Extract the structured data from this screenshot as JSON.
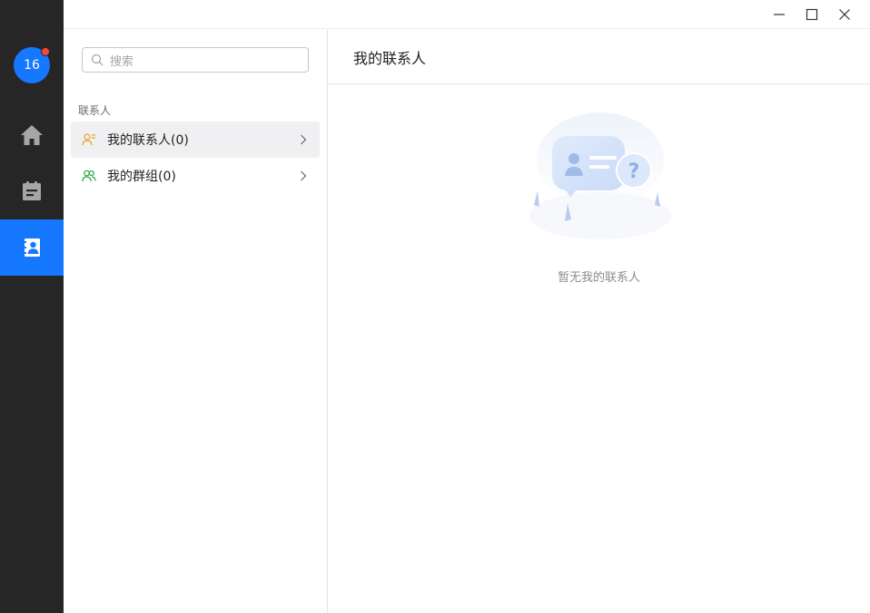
{
  "user": {
    "avatar_text": "16",
    "has_notification": true
  },
  "rail": [
    {
      "name": "home",
      "icon": "home-icon",
      "active": false
    },
    {
      "name": "notes",
      "icon": "clipboard-icon",
      "active": false
    },
    {
      "name": "contacts",
      "icon": "contacts-book-icon",
      "active": true
    }
  ],
  "window_controls": {
    "minimize": "minimize-icon",
    "maximize": "maximize-icon",
    "close": "close-icon"
  },
  "search": {
    "placeholder": "搜索"
  },
  "contacts_section": {
    "label": "联系人",
    "items": [
      {
        "label": "我的联系人(0)",
        "icon": "person-card-icon",
        "icon_color": "#f0a020",
        "selected": true
      },
      {
        "label": "我的群组(0)",
        "icon": "group-icon",
        "icon_color": "#28a745",
        "selected": false
      }
    ]
  },
  "main": {
    "title": "我的联系人",
    "empty_text": "暂无我的联系人"
  },
  "colors": {
    "accent": "#1677ff",
    "rail_bg": "#262626",
    "badge": "#f5483b"
  }
}
